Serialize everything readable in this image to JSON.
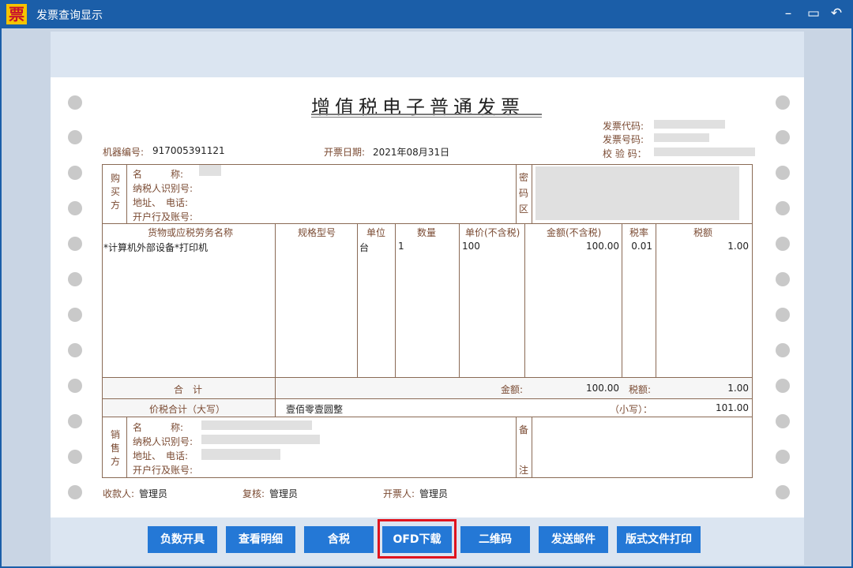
{
  "window": {
    "icon_text": "票",
    "title": "发票查询显示",
    "minimize": "–",
    "maximize": "▭",
    "back": "↶"
  },
  "invoice": {
    "title": "增值税电子普通发票",
    "code_label": "发票代码:",
    "number_label": "发票号码:",
    "check_label": "校 验 码：",
    "machine_label": "机器编号:",
    "machine_value": "917005391121",
    "date_label": "开票日期:",
    "date_value": "2021年08月31日",
    "buyer_side": "购\n买\n方",
    "buyer_fields": {
      "name": "名　　　称:",
      "tax_id": "纳税人识别号:",
      "address": "地址、　电话:",
      "bank": "开户行及账号:"
    },
    "cipher_label": "密\n码\n区",
    "columns": {
      "item": "货物或应税劳务名称",
      "spec": "规格型号",
      "unit": "单位",
      "qty": "数量",
      "price": "单价(不含税)",
      "amount": "金额(不含税)",
      "rate": "税率",
      "tax": "税额"
    },
    "row": {
      "item": "*计算机外部设备*打印机",
      "unit": "台",
      "qty": "1",
      "price": "100",
      "amount": "100.00",
      "rate": "0.01",
      "tax": "1.00"
    },
    "total": {
      "label": "合　计",
      "amount_label": "金额:",
      "amount": "100.00",
      "tax_label": "税额:",
      "tax": "1.00"
    },
    "grand_total": {
      "label": "价税合计（大写）",
      "words": "壹佰零壹圆整",
      "small_label": "（小写）：",
      "small_value": "101.00"
    },
    "seller_side": "销\n售\n方",
    "seller_fields": {
      "name": "名　　　称:",
      "tax_id": "纳税人识别号:",
      "address": "地址、　电话:",
      "bank": "开户行及账号:"
    },
    "remark_label": "备",
    "remark_label2": "注",
    "payee_label": "收款人:",
    "payee": "管理员",
    "reviewer_label": "复核:",
    "reviewer": "管理员",
    "issuer_label": "开票人:",
    "issuer": "管理员"
  },
  "buttons": {
    "negative": "负数开具",
    "details": "查看明细",
    "tax_incl": "含税",
    "ofd": "OFD下载",
    "qrcode": "二维码",
    "email": "发送邮件",
    "print": "版式文件打印"
  },
  "colors": {
    "titlebar": "#1b5ea8",
    "button": "#2478d6",
    "highlight": "#e0141e"
  }
}
